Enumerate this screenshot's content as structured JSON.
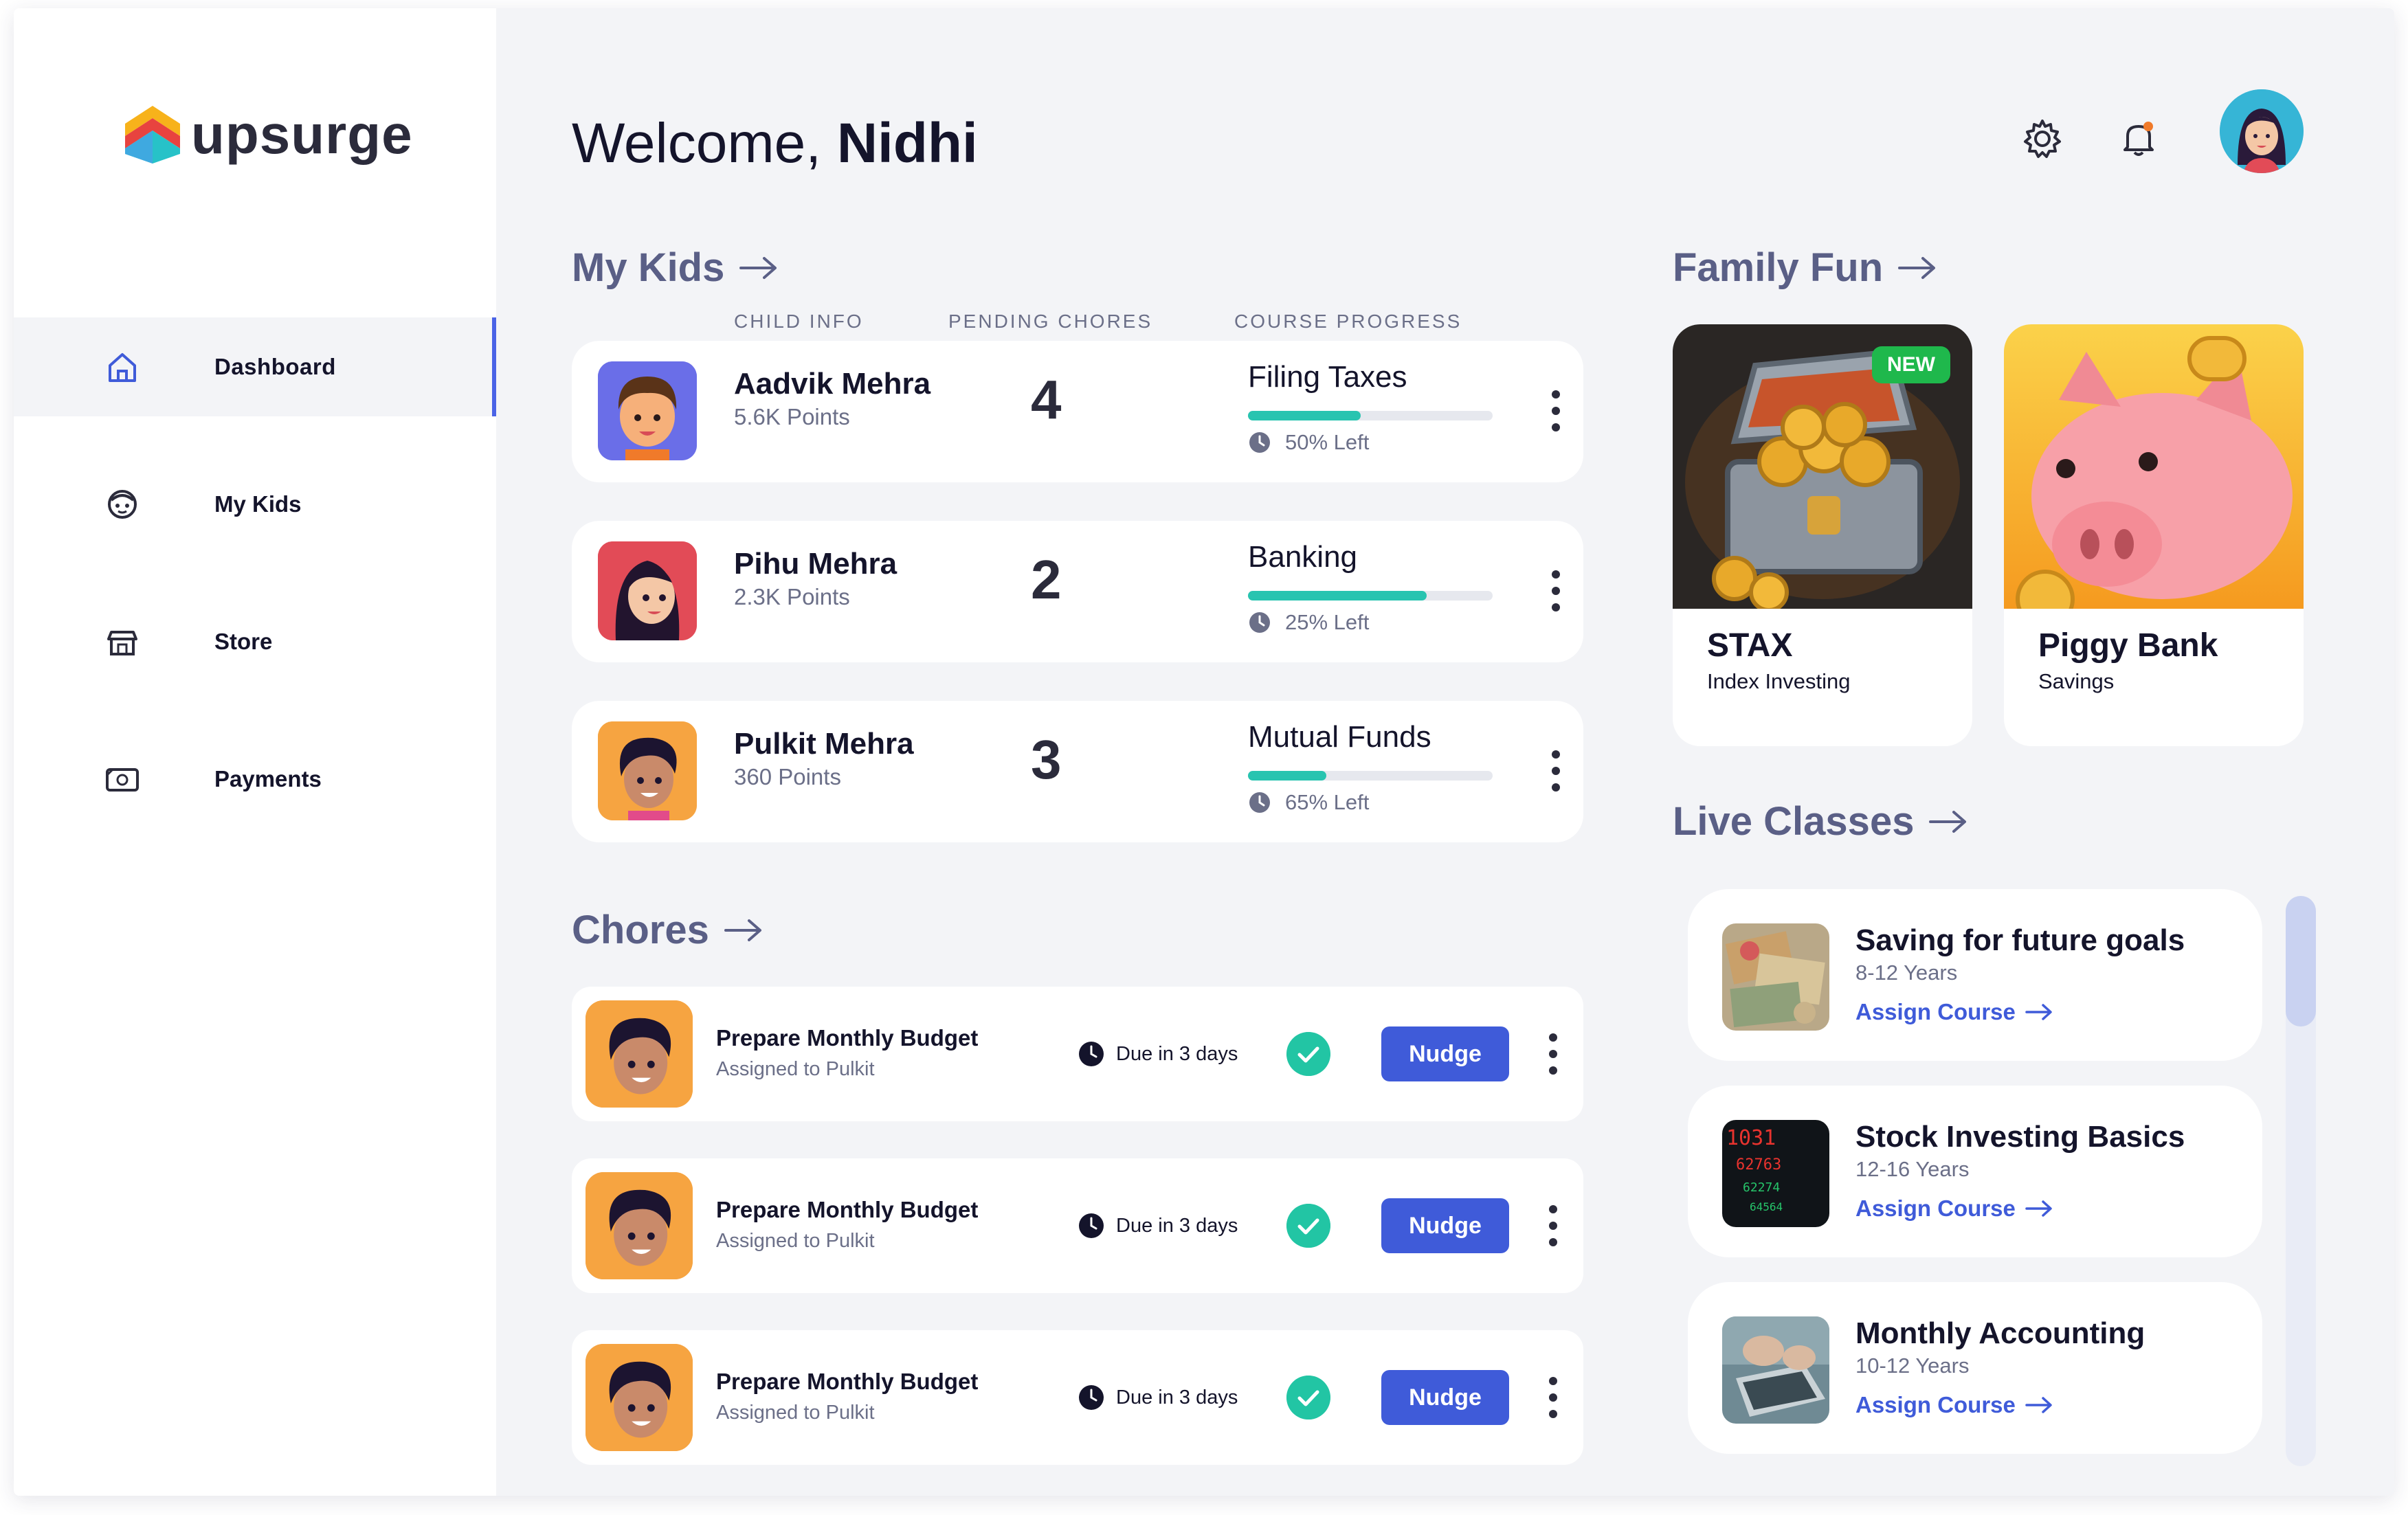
{
  "app": {
    "logo_text": "upsurge"
  },
  "sidebar": {
    "items": [
      {
        "label": "Dashboard",
        "icon": "home-icon",
        "active": true
      },
      {
        "label": "My Kids",
        "icon": "kid-face-icon",
        "active": false
      },
      {
        "label": "Store",
        "icon": "store-icon",
        "active": false
      },
      {
        "label": "Payments",
        "icon": "payments-icon",
        "active": false
      }
    ]
  },
  "header": {
    "welcome_prefix": "Welcome,",
    "user_name": "Nidhi",
    "settings_icon": "gear-icon",
    "notification_icon": "bell-icon"
  },
  "my_kids": {
    "title": "My Kids",
    "columns": [
      "CHILD INFO",
      "PENDING CHORES",
      "COURSE PROGRESS"
    ],
    "kids": [
      {
        "name": "Aadvik Mehra",
        "points": "5.6K Points",
        "pending": "4",
        "course": "Filing Taxes",
        "progress": 0.46,
        "left": "50% Left",
        "avatar_bg": "#6a6ee8"
      },
      {
        "name": "Pihu Mehra",
        "points": "2.3K Points",
        "pending": "2",
        "course": "Banking",
        "progress": 0.73,
        "left": "25% Left",
        "avatar_bg": "#e24b57"
      },
      {
        "name": "Pulkit Mehra",
        "points": "360 Points",
        "pending": "3",
        "course": "Mutual Funds",
        "progress": 0.32,
        "left": "65% Left",
        "avatar_bg": "#f6a441"
      }
    ]
  },
  "chores": {
    "title": "Chores",
    "items": [
      {
        "title": "Prepare Monthly Budget",
        "assigned": "Assigned to Pulkit",
        "due": "Due in 3 days",
        "action": "Nudge"
      },
      {
        "title": "Prepare Monthly Budget",
        "assigned": "Assigned to Pulkit",
        "due": "Due in 3 days",
        "action": "Nudge"
      },
      {
        "title": "Prepare Monthly Budget",
        "assigned": "Assigned to Pulkit",
        "due": "Due in 3 days",
        "action": "Nudge"
      }
    ]
  },
  "family_fun": {
    "title": "Family Fun",
    "items": [
      {
        "title": "STAX",
        "subtitle": "Index Investing",
        "badge": "NEW"
      },
      {
        "title": "Piggy Bank",
        "subtitle": "Savings"
      }
    ]
  },
  "live_classes": {
    "title": "Live Classes",
    "items": [
      {
        "title": "Saving for future goals",
        "age": "8-12 Years",
        "action": "Assign Course"
      },
      {
        "title": "Stock Investing Basics",
        "age": "12-16 Years",
        "action": "Assign Course"
      },
      {
        "title": "Monthly Accounting",
        "age": "10-12 Years",
        "action": "Assign Course"
      }
    ]
  },
  "colors": {
    "accent": "#3f5bd9",
    "progress": "#28c4b0",
    "success": "#22c5a4",
    "section_title": "#5a5f86",
    "new_badge": "#1fb84c"
  }
}
